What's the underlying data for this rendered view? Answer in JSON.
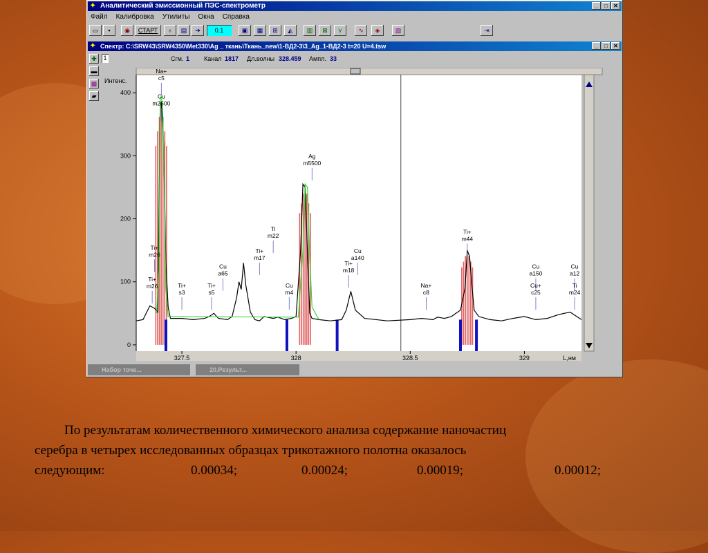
{
  "window": {
    "title": "Аналитический эмиссионный ПЭС-спектрометр",
    "menu": [
      "Файл",
      "Калибровка",
      "Утилиты",
      "Окна",
      "Справка"
    ]
  },
  "toolbar": {
    "start_label": "СТАРТ",
    "value": "0.1"
  },
  "spectrum_window": {
    "title": "Спектр: C:\\SRW43\\SRW4350\\Met330\\Ag _ ткань\\Ткань_new\\1-ВД2-3\\3_Ag_1-ВД2-3   t=20 U=4.tsw",
    "info": {
      "index": "1",
      "sgm_label": "Сгм.",
      "sgm_value": "1",
      "channel_label": "Канал",
      "channel_value": "1817",
      "wavelength_label": "Дл.волны",
      "wavelength_value": "328.459",
      "amp_label": "Ампл.",
      "amp_value": "33"
    },
    "y_label": "Интенс.",
    "x_unit": "L,нм"
  },
  "tasks": [
    {
      "label": "Набор точе..."
    },
    {
      "label": "20.Результ..."
    }
  ],
  "chart_data": {
    "type": "line",
    "xlim": [
      327.3,
      329.25
    ],
    "ylim": [
      -10,
      420
    ],
    "x_ticks": [
      327.5,
      328,
      328.5,
      329
    ],
    "x_tick_labels": [
      "327.5",
      "328",
      "328.5",
      "329"
    ],
    "y_ticks": [
      0,
      100,
      200,
      300,
      400
    ],
    "y_tick_labels": [
      "0",
      "100",
      "200",
      "300",
      "400"
    ],
    "cursor_x": 328.459,
    "series": [
      {
        "color": "#000000",
        "x": [
          327.3,
          327.33,
          327.36,
          327.38,
          327.395,
          327.405,
          327.41,
          327.42,
          327.43,
          327.44,
          327.45,
          327.5,
          327.55,
          327.6,
          327.62,
          327.64,
          327.66,
          327.7,
          327.72,
          327.74,
          327.75,
          327.76,
          327.77,
          327.78,
          327.8,
          327.82,
          327.84,
          327.86,
          327.9,
          327.92,
          327.95,
          327.98,
          328,
          328.02,
          328.03,
          328.04,
          328.05,
          328.06,
          328.07,
          328.1,
          328.15,
          328.2,
          328.22,
          328.24,
          328.26,
          328.3,
          328.4,
          328.5,
          328.55,
          328.6,
          328.62,
          328.65,
          328.68,
          328.7,
          328.72,
          328.74,
          328.75,
          328.76,
          328.77,
          328.78,
          328.8,
          328.85,
          328.9,
          328.95,
          329,
          329.05,
          329.1,
          329.15,
          329.2,
          329.25
        ],
        "y": [
          38,
          40,
          62,
          58,
          52,
          380,
          385,
          320,
          130,
          60,
          42,
          42,
          40,
          42,
          45,
          50,
          42,
          40,
          45,
          75,
          100,
          88,
          130,
          95,
          52,
          40,
          38,
          45,
          42,
          44,
          40,
          42,
          45,
          150,
          255,
          250,
          145,
          50,
          42,
          40,
          38,
          40,
          55,
          85,
          55,
          42,
          38,
          40,
          42,
          40,
          44,
          42,
          45,
          50,
          55,
          90,
          150,
          140,
          95,
          55,
          45,
          40,
          38,
          42,
          45,
          40,
          42,
          48,
          52,
          40
        ]
      },
      {
        "color": "#33dd33",
        "x": [
          327.39,
          327.4,
          327.405,
          327.41,
          327.415,
          327.42,
          327.425,
          327.43,
          327.44,
          328.01,
          328.03,
          328.04,
          328.05,
          328.06,
          328.07,
          328.1
        ],
        "y": [
          50,
          120,
          390,
          395,
          380,
          320,
          200,
          90,
          45,
          44,
          150,
          255,
          250,
          140,
          60,
          40
        ]
      }
    ],
    "peak_bands": [
      {
        "x": 327.41,
        "top": 385
      },
      {
        "x": 328.04,
        "top": 255
      },
      {
        "x": 328.75,
        "top": 150
      }
    ],
    "baseline_marks": [
      327.43,
      327.96,
      328.18,
      328.72,
      328.79
    ],
    "labels": [
      {
        "x": 327.37,
        "y": 90,
        "lines": [
          "Ti+",
          "m26"
        ]
      },
      {
        "x": 327.38,
        "y": 140,
        "lines": [
          "Ti+",
          "m26"
        ]
      },
      {
        "x": 327.41,
        "y": 420,
        "lines": [
          "Na+",
          "c5"
        ]
      },
      {
        "x": 327.41,
        "y": 380,
        "lines": [
          "Cu",
          "m2500"
        ]
      },
      {
        "x": 327.5,
        "y": 80,
        "lines": [
          "Ti+",
          "s3"
        ]
      },
      {
        "x": 327.63,
        "y": 80,
        "lines": [
          "Ti+",
          "s5"
        ]
      },
      {
        "x": 327.68,
        "y": 110,
        "lines": [
          "Cu",
          "a65"
        ]
      },
      {
        "x": 327.84,
        "y": 135,
        "lines": [
          "Ti+",
          "m17"
        ]
      },
      {
        "x": 327.9,
        "y": 170,
        "lines": [
          "Ti",
          "m22"
        ]
      },
      {
        "x": 327.97,
        "y": 80,
        "lines": [
          "Cu",
          "m4"
        ]
      },
      {
        "x": 328.07,
        "y": 285,
        "lines": [
          "Ag",
          "m5500"
        ]
      },
      {
        "x": 328.23,
        "y": 115,
        "lines": [
          "Ti+",
          "m18"
        ]
      },
      {
        "x": 328.27,
        "y": 135,
        "lines": [
          "Cu",
          "a140"
        ]
      },
      {
        "x": 328.57,
        "y": 80,
        "lines": [
          "Na+",
          "c8"
        ]
      },
      {
        "x": 328.75,
        "y": 165,
        "lines": [
          "Ti+",
          "m44"
        ]
      },
      {
        "x": 329.05,
        "y": 110,
        "lines": [
          "Cu",
          "a150"
        ]
      },
      {
        "x": 329.05,
        "y": 80,
        "lines": [
          "Cu+",
          "c25"
        ]
      },
      {
        "x": 329.22,
        "y": 110,
        "lines": [
          "Cu",
          "a12"
        ]
      },
      {
        "x": 329.22,
        "y": 80,
        "lines": [
          "Ti",
          "m24"
        ]
      }
    ]
  },
  "paragraph": {
    "line1": "По результатам количественного химического анализа содержание наночастиц",
    "line2": "серебра в четырех исследованных  образцах трикотажного полотна оказалось",
    "line3_label": "следующим:",
    "values": [
      "0.00034;",
      "0.00024;",
      "0.00019;",
      "0.00012;"
    ]
  }
}
